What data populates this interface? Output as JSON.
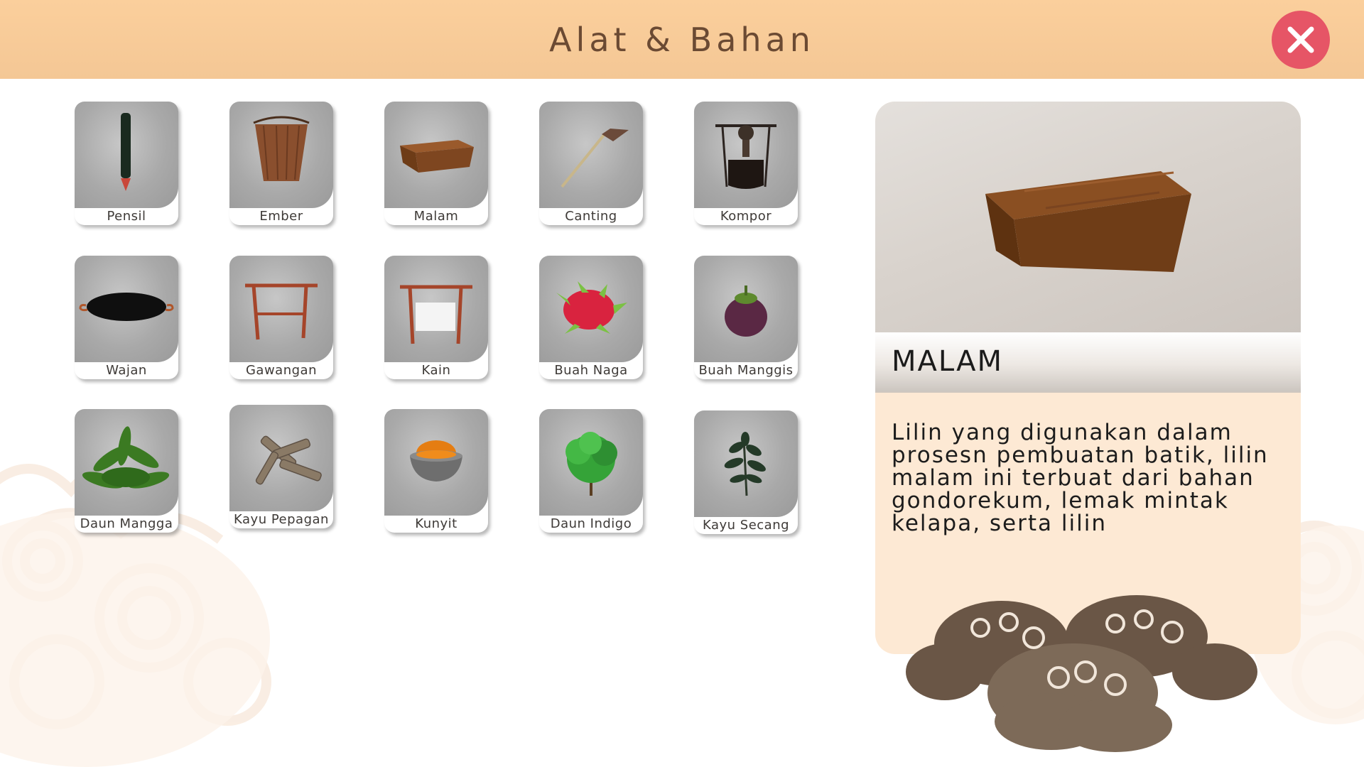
{
  "header": {
    "title": "Alat & Bahan"
  },
  "close_button": {
    "icon": "close-icon",
    "color": "#e65566"
  },
  "items": [
    {
      "label": "Pensil",
      "icon": "pencil-icon"
    },
    {
      "label": "Ember",
      "icon": "bucket-icon"
    },
    {
      "label": "Malam",
      "icon": "wax-block-icon"
    },
    {
      "label": "Canting",
      "icon": "canting-icon"
    },
    {
      "label": "Kompor",
      "icon": "stove-icon"
    },
    {
      "label": "Wajan",
      "icon": "wok-icon"
    },
    {
      "label": "Gawangan",
      "icon": "rack-icon"
    },
    {
      "label": "Kain",
      "icon": "cloth-rack-icon"
    },
    {
      "label": "Buah Naga",
      "icon": "dragon-fruit-icon"
    },
    {
      "label": "Buah Manggis",
      "icon": "mangosteen-icon"
    },
    {
      "label": "Daun Mangga",
      "icon": "mango-leaves-icon"
    },
    {
      "label": "Kayu Pepagan",
      "icon": "bark-wood-icon"
    },
    {
      "label": "Kunyit",
      "icon": "turmeric-bowl-icon"
    },
    {
      "label": "Daun Indigo",
      "icon": "indigo-bush-icon"
    },
    {
      "label": "Kayu Secang",
      "icon": "secang-plant-icon"
    }
  ],
  "detail": {
    "title": "MALAM",
    "description": "Lilin yang digunakan dalam prosesn pembuatan batik, lilin malam ini terbuat dari bahan gondorekum, lemak mintak kelapa, serta lilin"
  },
  "colors": {
    "header_bg": "#fbcf9c",
    "title_text": "#6b4a33",
    "panel_bg": "#fde9d4",
    "cloud_brown": "#6e5a4a"
  }
}
